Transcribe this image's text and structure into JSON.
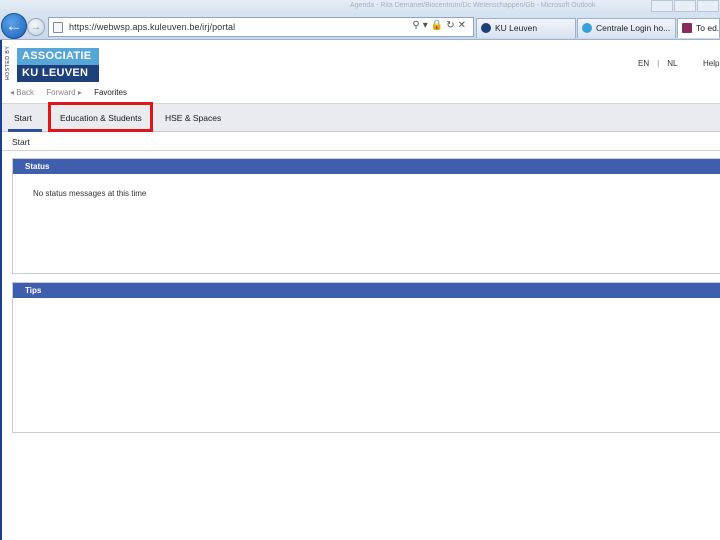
{
  "browser": {
    "window_title": "Agenda - Rita Demanet/Biocentrum/Dc Wetenschappen/Gb - Microsoft Outlook",
    "url": "https://webwsp.aps.kuleuven.be/irj/portal",
    "tabs": [
      {
        "label": "KU Leuven",
        "icon_color": "#1d3f7a",
        "active": false
      },
      {
        "label": "Centrale Login ho...",
        "icon_color": "#3aa0d8",
        "active": false
      },
      {
        "label": "To ed...",
        "icon_color": "#8a2b5e",
        "active": true
      }
    ]
  },
  "logo": {
    "hosted_by": "HOSTED BY",
    "line1": "ASSOCIATIE",
    "line2": "KU LEUVEN",
    "colors": {
      "top": "#56a6d8",
      "bottom": "#1d3f7a"
    }
  },
  "header_links": {
    "lang_en": "EN",
    "lang_nl": "NL",
    "help": "Help"
  },
  "history_nav": {
    "back": "◂ Back",
    "forward": "Forward ▸",
    "favorites": "Favorites"
  },
  "main_nav": {
    "tabs": [
      "Start",
      "Education & Students",
      "HSE & Spaces"
    ],
    "selected": "Start",
    "highlighted": "Education & Students",
    "highlight_color": "#e0151c"
  },
  "breadcrumb": "Start",
  "panels": {
    "status": {
      "title": "Status",
      "message": "No status messages at this time"
    },
    "tips": {
      "title": "Tips"
    },
    "header_color": "#3f5fae"
  }
}
